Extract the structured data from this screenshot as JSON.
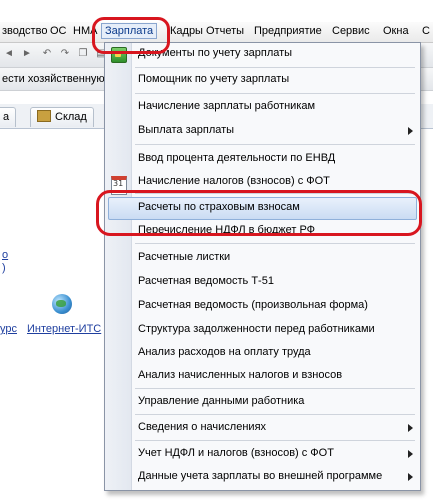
{
  "menubar": {
    "items": [
      "зводство",
      "ОС",
      "НМА",
      "Зарплата",
      "Кадры",
      "Отчеты",
      "Предприятие",
      "Сервис",
      "Окна",
      "С"
    ],
    "active": "Зарплата"
  },
  "toolbar2": {
    "text": "ести хозяйственную"
  },
  "tabs": [
    {
      "label": "а"
    },
    {
      "label": "Склад"
    }
  ],
  "background": {
    "link_top": "о",
    "link_top2": ")",
    "link_left": "урс",
    "link_internet": "Интернет-ИТС"
  },
  "dropdown": {
    "items": [
      {
        "label": "Документы по учету зарплаты",
        "icon": "document-green-icon",
        "submenu": false
      },
      {
        "label": "Помощник по учету зарплаты",
        "icon": "",
        "submenu": false
      },
      {
        "label": "Начисление зарплаты работникам",
        "icon": "",
        "submenu": false
      },
      {
        "label": "Выплата зарплаты",
        "icon": "",
        "submenu": true
      },
      {
        "label": "Ввод процента деятельности по ЕНВД",
        "icon": "",
        "submenu": false
      },
      {
        "label": "Начисление налогов (взносов) с ФОТ",
        "icon": "calendar-icon",
        "submenu": false
      },
      {
        "label": "Расчеты по страховым взносам",
        "icon": "",
        "submenu": false,
        "highlighted": true
      },
      {
        "label": "Перечисление НДФЛ в бюджет РФ",
        "icon": "",
        "submenu": false
      },
      {
        "label": "Расчетные листки",
        "icon": "",
        "submenu": false
      },
      {
        "label": "Расчетная ведомость Т-51",
        "icon": "",
        "submenu": false
      },
      {
        "label": "Расчетная ведомость (произвольная форма)",
        "icon": "",
        "submenu": false
      },
      {
        "label": "Структура задолженности перед работниками",
        "icon": "",
        "submenu": false
      },
      {
        "label": "Анализ расходов на оплату труда",
        "icon": "",
        "submenu": false
      },
      {
        "label": "Анализ начисленных налогов и взносов",
        "icon": "",
        "submenu": false
      },
      {
        "label": "Управление данными работника",
        "icon": "",
        "submenu": false
      },
      {
        "label": "Сведения о начислениях",
        "icon": "",
        "submenu": true
      },
      {
        "label": "Учет НДФЛ и налогов (взносов) с ФОТ",
        "icon": "",
        "submenu": true
      },
      {
        "label": "Данные учета зарплаты во внешней программе",
        "icon": "",
        "submenu": true
      }
    ]
  },
  "colors": {
    "annotation_red": "#d8161f",
    "highlight_blue": "#cadcf3",
    "link_blue": "#1f3f9f"
  }
}
